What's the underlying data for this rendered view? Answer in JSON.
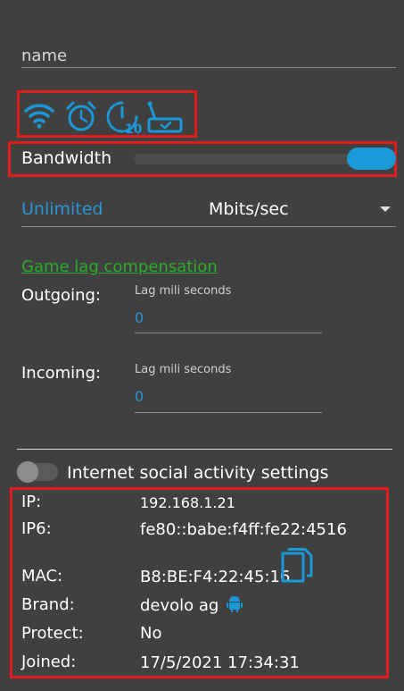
{
  "name_field": {
    "placeholder": "name"
  },
  "icons": [
    "wifi-icon",
    "alarm-clock-icon",
    "timer-10-icon",
    "router-icon"
  ],
  "bandwidth": {
    "label": "Bandwidth",
    "enabled": true
  },
  "speed": {
    "limit": "Unlimited",
    "unit": "Mbits/sec"
  },
  "game_lag": {
    "title": "Game lag compensation",
    "outgoing": {
      "label": "Outgoing:",
      "sublabel": "Lag mili seconds",
      "value": "0"
    },
    "incoming": {
      "label": "Incoming:",
      "sublabel": "Lag mili seconds",
      "value": "0"
    }
  },
  "social": {
    "label": "Internet social activity settings",
    "enabled": false
  },
  "info": {
    "ip_label": "IP:",
    "ip": "192.168.1.21",
    "ip6_label": "IP6:",
    "ip6": "fe80::babe:f4ff:fe22:4516",
    "mac_label": "MAC:",
    "mac": "B8:BE:F4:22:45:16",
    "brand_label": "Brand:",
    "brand": "devolo ag",
    "protect_label": "Protect:",
    "protect": "No",
    "joined_label": "Joined:",
    "joined": "17/5/2021 17:34:31"
  },
  "colors": {
    "background": "#404040",
    "accent": "#1b98d8",
    "link_green": "#2aad2a",
    "highlight_red": "#e01b1b"
  }
}
